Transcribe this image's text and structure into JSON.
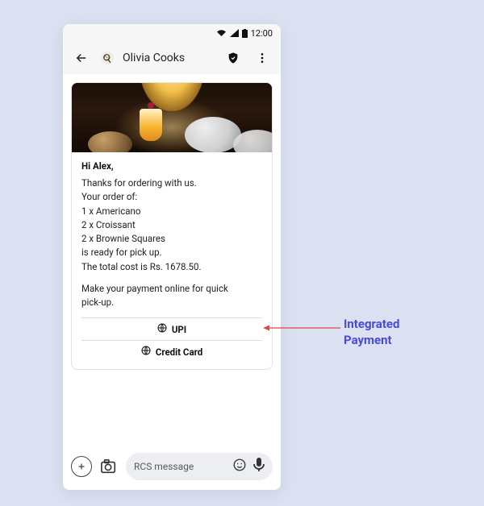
{
  "status": {
    "time": "12:00"
  },
  "header": {
    "title": "Olivia Cooks"
  },
  "card": {
    "greeting": "Hi Alex,",
    "lines": [
      "Thanks for ordering with us.",
      "Your order of:",
      "1 x Americano",
      "2 x Croissant",
      "2 x Brownie Squares",
      "is ready for pick up.",
      "The total cost is Rs. 1678.50."
    ],
    "cta_lines": [
      "Make your payment online for quick",
      "pick-up."
    ],
    "payments": {
      "upi": "UPI",
      "card": "Credit Card"
    }
  },
  "composer": {
    "placeholder": "RCS message"
  },
  "annotation": {
    "line1": "Integrated",
    "line2": "Payment"
  }
}
